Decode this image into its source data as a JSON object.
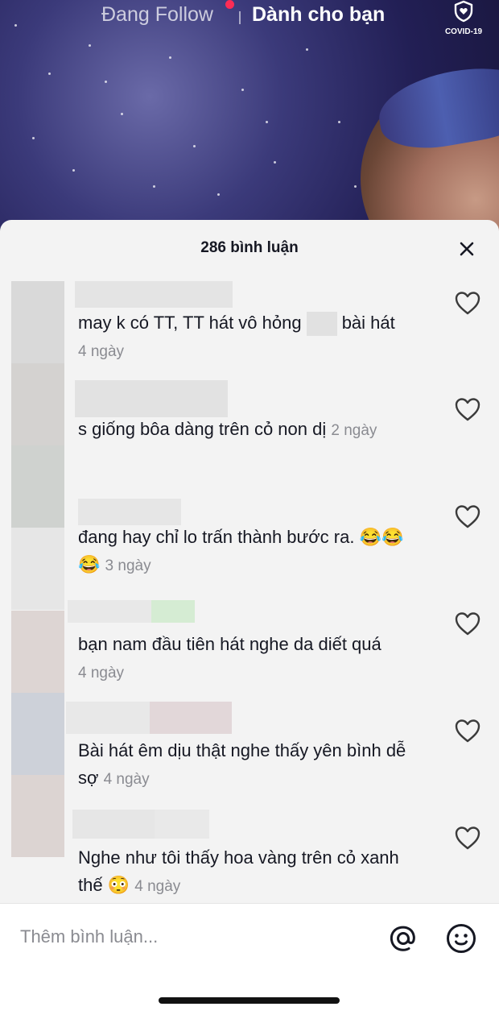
{
  "top_nav": {
    "following_tab": "Đang Follow",
    "for_you_tab": "Dành cho bạn",
    "covid_label": "COVID-19"
  },
  "comments_sheet": {
    "title": "286 bình luận",
    "comments": [
      {
        "text": "may k có TT, TT hát vô hỏng",
        "text_after_blur": " bài hát",
        "time": "4 ngày"
      },
      {
        "text": "s giống bôa dàng trên cỏ non dị",
        "time": "2 ngày"
      },
      {
        "text": "đang hay chỉ lo trấn thành bước ra. 😂😂😂",
        "time": "3 ngày"
      },
      {
        "text": "bạn nam đầu tiên hát nghe da diết quá",
        "time": "4 ngày"
      },
      {
        "text": "Bài hát êm dịu thật nghe thấy yên bình dễ sợ",
        "time": "4 ngày"
      },
      {
        "text": "Nghe như tôi thấy hoa vàng trên cỏ xanh thế 😳",
        "time": "4 ngày"
      }
    ]
  },
  "input_bar": {
    "placeholder": "Thêm bình luận..."
  },
  "icons": {
    "close": "close-icon",
    "like": "heart-outline-icon",
    "mention": "at-sign-icon",
    "emoji": "smiley-face-icon",
    "covid": "shield-heart-icon"
  },
  "colors": {
    "accent": "#fe2c55",
    "sheet_bg": "#f3f3f3",
    "muted_text": "#8a8b91"
  }
}
